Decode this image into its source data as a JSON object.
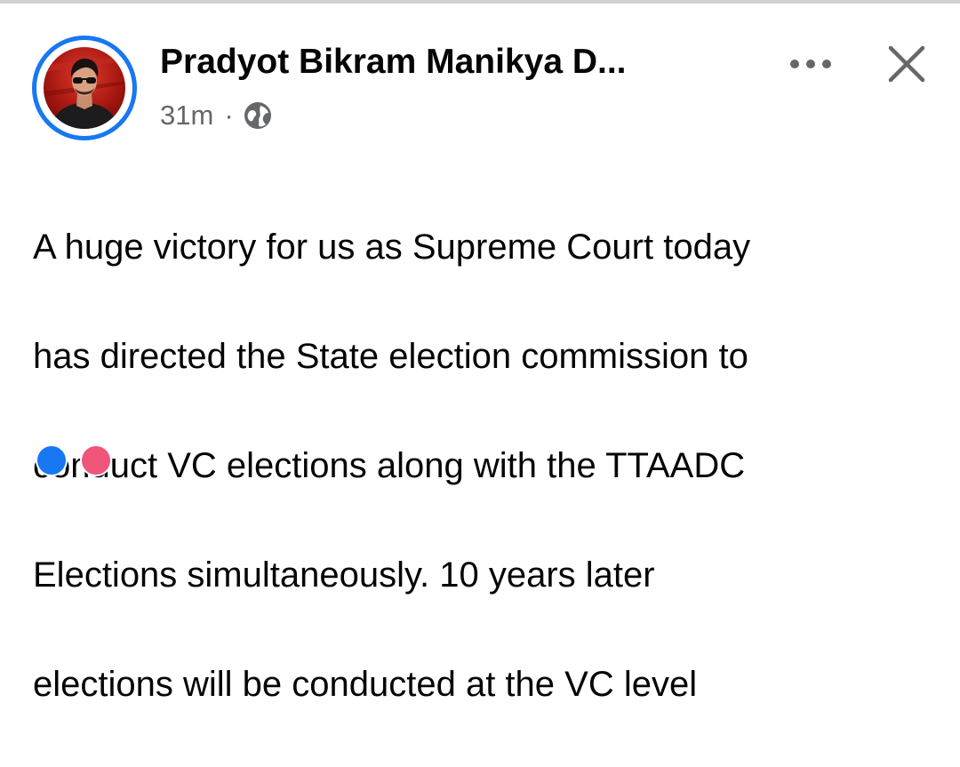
{
  "post": {
    "author": "Pradyot Bikram Manikya D...",
    "time": "31m",
    "separator": "·",
    "audience_icon": "globe-icon",
    "text_lines": [
      "A huge victory for us as Supreme Court today",
      "has directed  the State election commission to",
      "conduct VC elections along with the TTAADC",
      "Elections simultaneously. 10 years later",
      "elections will be conducted at the VC level"
    ]
  },
  "actions": {
    "more_icon": "more-horizontal-icon",
    "close_icon": "close-icon"
  },
  "reactions": [
    "like-reaction-icon",
    "love-reaction-icon"
  ],
  "colors": {
    "accent": "#1877f2",
    "text": "#050505",
    "secondary_text": "#65676b",
    "icon": "#65676b",
    "love": "#f0557a"
  }
}
